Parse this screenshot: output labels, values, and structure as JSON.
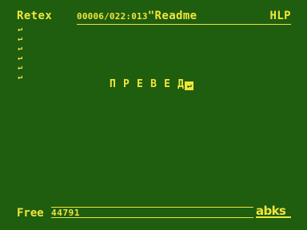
{
  "header": {
    "app_name": "Retex",
    "cursor_position": "00006/022:013",
    "document_name": "\"Readme",
    "help_label": "HLP"
  },
  "editor": {
    "line_marker": "↵",
    "text": "ПРЕВЕД",
    "cursor_glyph": "↵"
  },
  "footer": {
    "free_label": "Free",
    "free_value": "44791",
    "brand": "abks"
  },
  "colors": {
    "background": "#1f5d0f",
    "foreground": "#f0e63a"
  }
}
